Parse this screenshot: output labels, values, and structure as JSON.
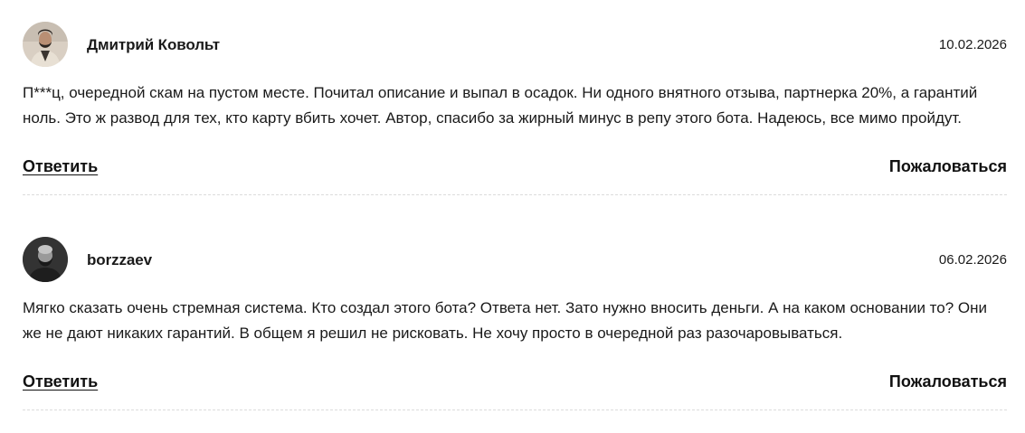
{
  "comments": [
    {
      "author": "Дмитрий Ковольт",
      "date": "10.02.2026",
      "text": "П***ц, очередной скам на пустом месте. Почитал описание и выпал в осадок. Ни одного внятного отзыва, партнерка 20%, а гарантий ноль. Это ж развод для тех, кто карту вбить хочет. Автор, спасибо за жирный минус в репу этого бота. Надеюсь, все мимо пройдут.",
      "reply_label": "Ответить",
      "report_label": "Пожаловаться"
    },
    {
      "author": "borzzaev",
      "date": "06.02.2026",
      "text": "Мягко сказать очень стремная система. Кто создал этого бота? Ответа нет. Зато нужно вносить деньги. А на каком основании то? Они же не дают никаких гарантий. В общем я решил не рисковать. Не хочу просто в очередной раз разочаровываться.",
      "reply_label": "Ответить",
      "report_label": "Пожаловаться"
    }
  ]
}
